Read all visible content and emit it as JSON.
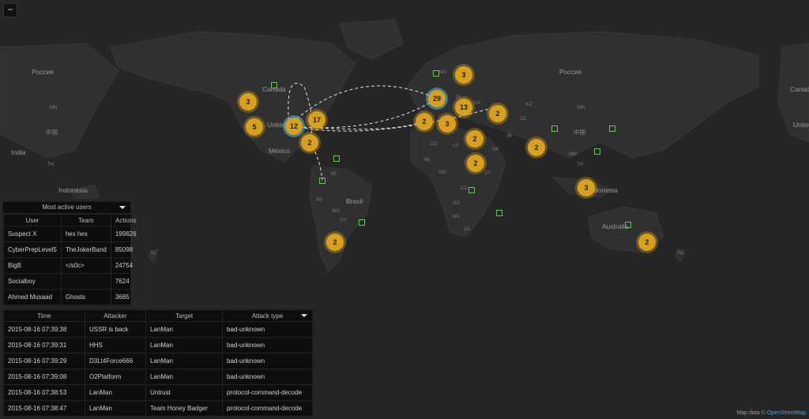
{
  "zoom_label": "−",
  "map_labels": {
    "russia_left": "Россия",
    "russia_right": "Россия",
    "canada_left": "Canada",
    "canada_right": "Canad",
    "usa": "United",
    "mexico": "México",
    "brasil": "Brasil",
    "india_left": "India",
    "china_left": "中国",
    "china_right": "中国",
    "indonesia_left": "Indonesia",
    "indonesia_right": "Indonesia",
    "australia": "Australia",
    "usa_right": "United",
    "mn_left": "MN",
    "mn_right": "MN",
    "mm": "MM",
    "th_left": "TH",
    "th_right": "TH",
    "nz_left": "NZ",
    "nz_right": "NZ",
    "kz": "KZ",
    "uz": "UZ",
    "ir": "IR",
    "sa": "SA",
    "no": "NO",
    "pl": "PL",
    "ua": "UA",
    "dz": "DZ",
    "ly": "LY",
    "ml": "ML",
    "ng": "NG",
    "et": "ET",
    "cd": "CD",
    "ao": "AO",
    "na": "NA",
    "za": "ZA",
    "ve": "VE",
    "pe": "PE",
    "bo": "BO",
    "py": "PY"
  },
  "clusters": [
    "3",
    "3",
    "5",
    "12",
    "17",
    "2",
    "29",
    "3",
    "13",
    "2",
    "3",
    "2",
    "2",
    "2",
    "2",
    "3",
    "2",
    "2"
  ],
  "users_panel": {
    "title": "Most active users",
    "headers": [
      "User",
      "Team",
      "Actions"
    ],
    "rows": [
      [
        "Suspect X",
        "hex hex",
        "199826"
      ],
      [
        "CyberPrepLevel5",
        "TheJokerBand",
        "85098"
      ],
      [
        "BigB",
        "</s0c>",
        "24754"
      ],
      [
        "Socialboy",
        "",
        "7624"
      ],
      [
        "Ahmed Musaad",
        "Ghosts",
        "3685"
      ]
    ]
  },
  "attacks_panel": {
    "headers": [
      "Time",
      "Attacker",
      "Target",
      "Attack type"
    ],
    "rows": [
      [
        "2015-08-16 07:39:38",
        "USSR is back",
        "LanMan",
        "bad-unknown"
      ],
      [
        "2015-08-16 07:39:31",
        "HHS",
        "LanMan",
        "bad-unknown"
      ],
      [
        "2015-08-16 07:39:29",
        "D3Lt4Force666",
        "LanMan",
        "bad-unknown"
      ],
      [
        "2015-08-16 07:39:08",
        "O2Platform",
        "LanMan",
        "bad-unknown"
      ],
      [
        "2015-08-16 07:38:53",
        "LanMan",
        "Untrust",
        "protocol-command-decode"
      ],
      [
        "2015-08-16 07:38:47",
        "LanMan",
        "Team Honey Badger",
        "protocol-command-decode"
      ]
    ]
  },
  "attribution": {
    "prefix": "Map data ©",
    "link": "OpenStreetMap"
  }
}
